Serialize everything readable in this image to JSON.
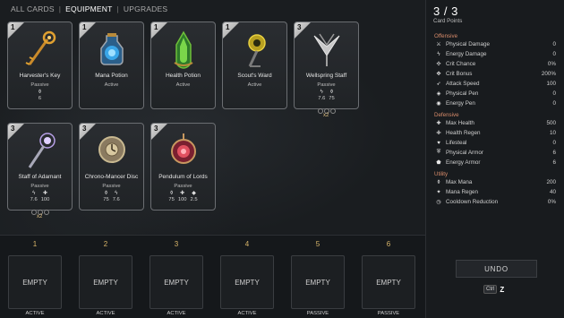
{
  "tabs": [
    {
      "label": "ALL CARDS"
    },
    {
      "label": "EQUIPMENT"
    },
    {
      "label": "UPGRADES"
    }
  ],
  "tab_separator": "|",
  "cards": [
    {
      "cost": "1",
      "name": "Harvester's Key",
      "type": "Passive",
      "icon": "key-icon",
      "stats": [
        {
          "icon": "flask-icon",
          "value": "6"
        }
      ]
    },
    {
      "cost": "1",
      "name": "Mana Potion",
      "type": "Active",
      "icon": "mana-potion-icon",
      "stats": []
    },
    {
      "cost": "1",
      "name": "Health Potion",
      "type": "Active",
      "icon": "health-potion-icon",
      "stats": []
    },
    {
      "cost": "1",
      "name": "Scout's Ward",
      "type": "Active",
      "icon": "ward-icon",
      "stats": []
    },
    {
      "cost": "3",
      "name": "Wellspring Staff",
      "type": "Passive",
      "icon": "wellspring-staff-icon",
      "stats": [
        {
          "icon": "bolt-icon",
          "value": "7.6"
        },
        {
          "icon": "flask-icon",
          "value": "75"
        }
      ],
      "multiplier": "x2"
    },
    {
      "cost": "3",
      "name": "Staff of Adamant",
      "type": "Passive",
      "icon": "adamant-staff-icon",
      "stats": [
        {
          "icon": "bolt-icon",
          "value": "7.6"
        },
        {
          "icon": "plus-icon",
          "value": "100"
        }
      ],
      "multiplier": "x2"
    },
    {
      "cost": "3",
      "name": "Chrono-Mancer Disc",
      "type": "Passive",
      "icon": "disc-icon",
      "stats": [
        {
          "icon": "flask-icon",
          "value": "75"
        },
        {
          "icon": "bolt-icon",
          "value": "7.6"
        }
      ]
    },
    {
      "cost": "3",
      "name": "Pendulum of Lords",
      "type": "Passive",
      "icon": "pendulum-icon",
      "stats": [
        {
          "icon": "flask-icon",
          "value": "75"
        },
        {
          "icon": "plus-icon",
          "value": "100"
        },
        {
          "icon": "diamond-icon",
          "value": "2.5"
        }
      ]
    }
  ],
  "slots": [
    {
      "number": "1",
      "content": "EMPTY",
      "type": "ACTIVE"
    },
    {
      "number": "2",
      "content": "EMPTY",
      "type": "ACTIVE"
    },
    {
      "number": "3",
      "content": "EMPTY",
      "type": "ACTIVE"
    },
    {
      "number": "4",
      "content": "EMPTY",
      "type": "ACTIVE"
    },
    {
      "number": "5",
      "content": "EMPTY",
      "type": "PASSIVE"
    },
    {
      "number": "6",
      "content": "EMPTY",
      "type": "PASSIVE"
    }
  ],
  "card_points": {
    "value": "3 / 3",
    "label": "Card Points"
  },
  "stat_sections": [
    {
      "title": "Offensive",
      "rows": [
        {
          "icon": "sword-icon",
          "label": "Physical Damage",
          "value": "0"
        },
        {
          "icon": "bolt-icon",
          "label": "Energy Damage",
          "value": "0"
        },
        {
          "icon": "crit-icon",
          "label": "Crit Chance",
          "value": "0%"
        },
        {
          "icon": "crit-bonus-icon",
          "label": "Crit Bonus",
          "value": "200%"
        },
        {
          "icon": "speed-icon",
          "label": "Attack Speed",
          "value": "100"
        },
        {
          "icon": "pen-icon",
          "label": "Physical Pen",
          "value": "0"
        },
        {
          "icon": "energy-pen-icon",
          "label": "Energy Pen",
          "value": "0"
        }
      ]
    },
    {
      "title": "Defensive",
      "rows": [
        {
          "icon": "plus-icon",
          "label": "Max Health",
          "value": "500"
        },
        {
          "icon": "regen-icon",
          "label": "Health Regen",
          "value": "10"
        },
        {
          "icon": "lifesteal-icon",
          "label": "Lifesteal",
          "value": "0"
        },
        {
          "icon": "shield-icon",
          "label": "Physical Armor",
          "value": "6"
        },
        {
          "icon": "energy-shield-icon",
          "label": "Energy Armor",
          "value": "6"
        }
      ]
    },
    {
      "title": "Utility",
      "rows": [
        {
          "icon": "flask-icon",
          "label": "Max Mana",
          "value": "200"
        },
        {
          "icon": "mana-regen-icon",
          "label": "Mana Regen",
          "value": "40"
        },
        {
          "icon": "clock-icon",
          "label": "Cooldown Reduction",
          "value": "0%"
        }
      ]
    }
  ],
  "undo": {
    "label": "UNDO",
    "key_modifier": "Ctrl",
    "key": "Z"
  },
  "colors": {
    "accent": "#d9b66a",
    "section_title": "#d98c6b",
    "background": "#15181b"
  }
}
